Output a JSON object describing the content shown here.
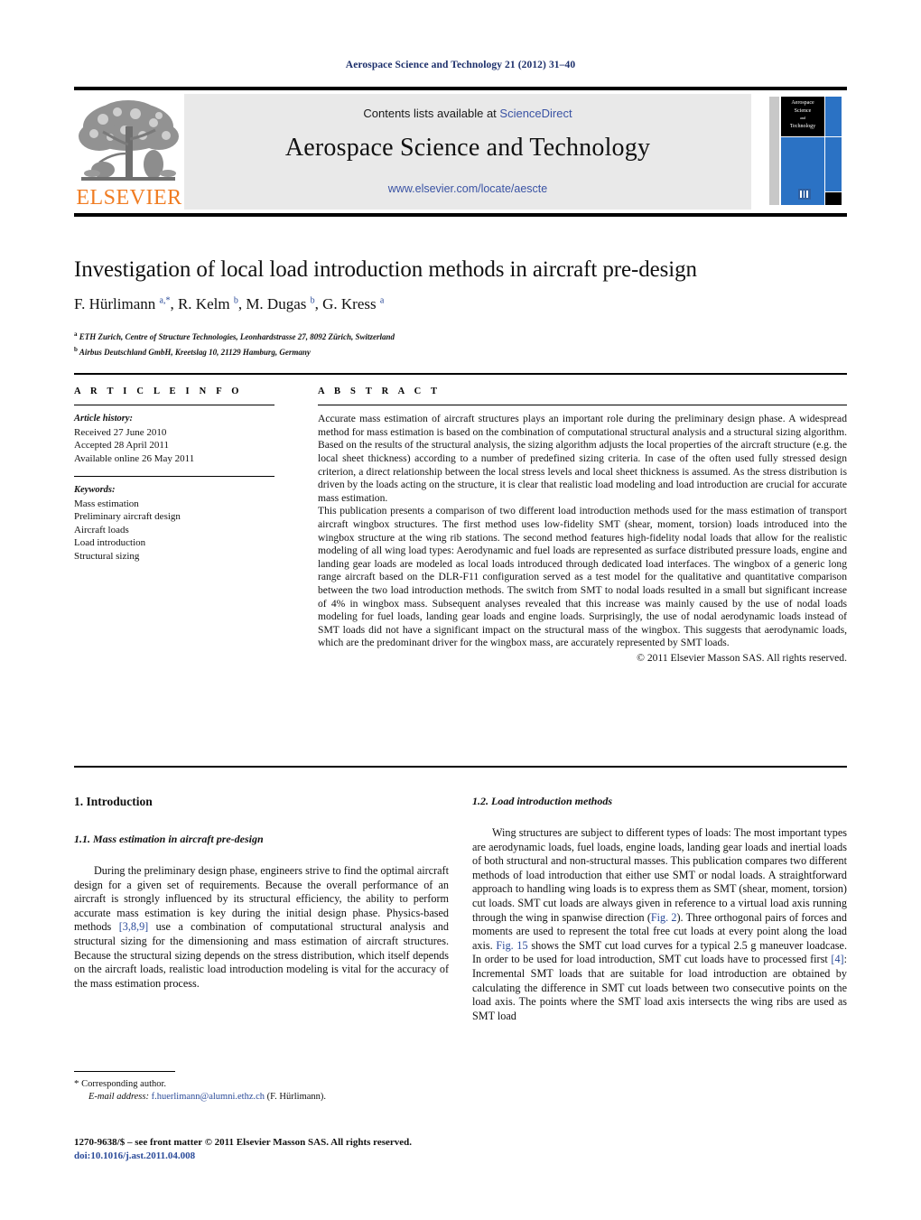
{
  "running_head": "Aerospace Science and Technology 21 (2012) 31–40",
  "masthead": {
    "contents_prefix": "Contents lists available at ",
    "sciencedirect": "ScienceDirect",
    "journal_name": "Aerospace Science and Technology",
    "url": "www.elsevier.com/locate/aescte",
    "publisher_logo_text": "ELSEVIER",
    "cover": {
      "line1": "Aerospace",
      "line2": "Science",
      "line3": "and",
      "line4": "Technology"
    },
    "colors": {
      "link": "#3a53a4",
      "banner_bg": "#e9e9e9",
      "cover_blue": "#2b72c4",
      "elsevier_orange": "#f07c22"
    }
  },
  "article": {
    "title": "Investigation of local load introduction methods in aircraft pre-design",
    "authors_html": "F. Hürlimann <sup>a,*</sup>, R. Kelm <sup>b</sup>, M. Dugas <sup>b</sup>, G. Kress <sup>a</sup>",
    "affiliations": [
      {
        "marker": "a",
        "text": "ETH Zurich, Centre of Structure Technologies, Leonhardstrasse 27, 8092 Zürich, Switzerland"
      },
      {
        "marker": "b",
        "text": "Airbus Deutschland GmbH, Kreetslag 10, 21129 Hamburg, Germany"
      }
    ]
  },
  "article_info": {
    "heading": "A R T I C L E   I N F O",
    "history_label": "Article history:",
    "history": [
      "Received 27 June 2010",
      "Accepted 28 April 2011",
      "Available online 26 May 2011"
    ],
    "keywords_label": "Keywords:",
    "keywords": [
      "Mass estimation",
      "Preliminary aircraft design",
      "Aircraft loads",
      "Load introduction",
      "Structural sizing"
    ]
  },
  "abstract": {
    "heading": "A B S T R A C T",
    "paragraphs": [
      "Accurate mass estimation of aircraft structures plays an important role during the preliminary design phase. A widespread method for mass estimation is based on the combination of computational structural analysis and a structural sizing algorithm. Based on the results of the structural analysis, the sizing algorithm adjusts the local properties of the aircraft structure (e.g. the local sheet thickness) according to a number of predefined sizing criteria. In case of the often used fully stressed design criterion, a direct relationship between the local stress levels and local sheet thickness is assumed. As the stress distribution is driven by the loads acting on the structure, it is clear that realistic load modeling and load introduction are crucial for accurate mass estimation.",
      "This publication presents a comparison of two different load introduction methods used for the mass estimation of transport aircraft wingbox structures. The first method uses low-fidelity SMT (shear, moment, torsion) loads introduced into the wingbox structure at the wing rib stations. The second method features high-fidelity nodal loads that allow for the realistic modeling of all wing load types: Aerodynamic and fuel loads are represented as surface distributed pressure loads, engine and landing gear loads are modeled as local loads introduced through dedicated load interfaces. The wingbox of a generic long range aircraft based on the DLR-F11 configuration served as a test model for the qualitative and quantitative comparison between the two load introduction methods. The switch from SMT to nodal loads resulted in a small but significant increase of 4% in wingbox mass. Subsequent analyses revealed that this increase was mainly caused by the use of nodal loads modeling for fuel loads, landing gear loads and engine loads. Surprisingly, the use of nodal aerodynamic loads instead of SMT loads did not have a significant impact on the structural mass of the wingbox. This suggests that aerodynamic loads, which are the predominant driver for the wingbox mass, are accurately represented by SMT loads."
    ],
    "copyright": "© 2011 Elsevier Masson SAS. All rights reserved."
  },
  "body": {
    "left": {
      "section_heading": "1. Introduction",
      "subsection_heading": "1.1. Mass estimation in aircraft pre-design",
      "paragraph_part1": "During the preliminary design phase, engineers strive to find the optimal aircraft design for a given set of requirements. Because the overall performance of an aircraft is strongly influenced by its structural efficiency, the ability to perform accurate mass estimation is key during the initial design phase. Physics-based methods ",
      "citation1": "[3,8,9]",
      "paragraph_part2": " use a combination of computational structural analysis and structural sizing for the dimensioning and mass estimation of aircraft structures. Because the structural sizing depends on the stress distribution, which itself depends on the aircraft loads, realistic load introduction modeling is vital for the accuracy of the mass estimation process."
    },
    "right": {
      "subsection_heading": "1.2. Load introduction methods",
      "part1": "Wing structures are subject to different types of loads: The most important types are aerodynamic loads, fuel loads, engine loads, landing gear loads and inertial loads of both structural and non-structural masses. This publication compares two different methods of load introduction that either use SMT or nodal loads. A straightforward approach to handling wing loads is to express them as SMT (shear, moment, torsion) cut loads. SMT cut loads are always given in reference to a virtual load axis running through the wing in spanwise direction (",
      "figref1": "Fig. 2",
      "part2": "). Three orthogonal pairs of forces and moments are used to represent the total free cut loads at every point along the load axis. ",
      "figref2": "Fig. 15",
      "part3": " shows the SMT cut load curves for a typical 2.5 g maneuver loadcase. In order to be used for load introduction, SMT cut loads have to processed first ",
      "citation2": "[4]",
      "part4": ": Incremental SMT loads that are suitable for load introduction are obtained by calculating the difference in SMT cut loads between two consecutive points on the load axis. The points where the SMT load axis intersects the wing ribs are used as SMT load"
    }
  },
  "footnotes": {
    "corresponding_marker": "*",
    "corresponding_text": "Corresponding author.",
    "email_label": "E-mail address:",
    "email": "f.huerlimann@alumni.ethz.ch",
    "email_owner": "(F. Hürlimann).",
    "imprint_line": "1270-9638/$ – see front matter © 2011 Elsevier Masson SAS. All rights reserved.",
    "doi": "doi:10.1016/j.ast.2011.04.008"
  }
}
